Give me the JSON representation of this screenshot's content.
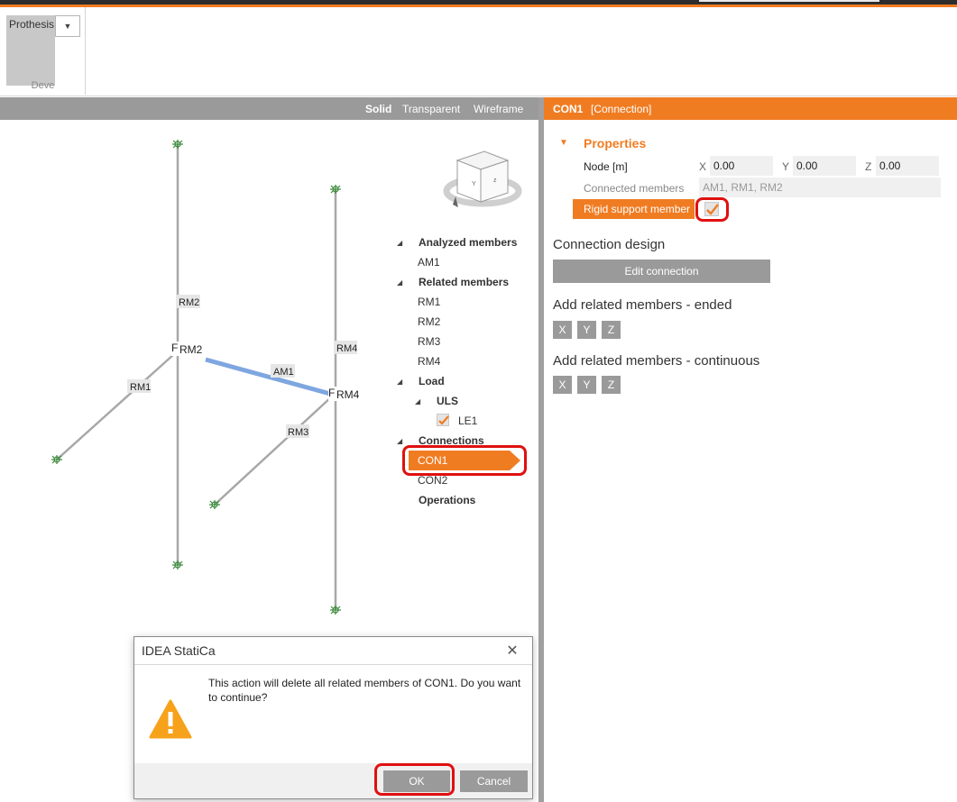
{
  "ribbon": {
    "button_label": "Prothesis",
    "dropdown_glyph": "▼",
    "group_caption": "Deve"
  },
  "view_bar": {
    "solid": "Solid",
    "transparent": "Transparent",
    "wireframe": "Wireframe"
  },
  "model": {
    "member_labels": [
      "RM2",
      "RM4",
      "RM1",
      "AM1",
      "RM3"
    ],
    "node_labels": [
      "RM2",
      "RM4"
    ],
    "node_prefix": "F",
    "support_icon": "support-icon",
    "view_cube_icon": "view-cube-icon",
    "cube_face_labels": [
      "Y",
      "z"
    ]
  },
  "tree": {
    "analyzed_members": "Analyzed members",
    "am1": "AM1",
    "related_members": "Related members",
    "rm1": "RM1",
    "rm2": "RM2",
    "rm3": "RM3",
    "rm4": "RM4",
    "load": "Load",
    "uls": "ULS",
    "le1": "LE1",
    "connections": "Connections",
    "con1": "CON1",
    "con2": "CON2",
    "operations": "Operations"
  },
  "right_panel": {
    "header_name": "CON1",
    "header_type": "[Connection]",
    "properties_title": "Properties",
    "node_label": "Node [m]",
    "x_axis": "X",
    "y_axis": "Y",
    "z_axis": "Z",
    "x_value": "0.00",
    "y_value": "0.00",
    "z_value": "0.00",
    "connected_members_label": "Connected members",
    "connected_members_value": "AM1, RM1, RM2",
    "rigid_support_label": "Rigid support member",
    "rigid_support_checked": true,
    "connection_design_title": "Connection design",
    "edit_connection": "Edit connection",
    "add_ended_title": "Add related members - ended",
    "add_continuous_title": "Add related members - continuous",
    "btn_x": "X",
    "btn_y": "Y",
    "btn_z": "Z"
  },
  "dialog": {
    "title": "IDEA StatiCa",
    "close_glyph": "✕",
    "message": "This action will delete all related members of CON1. Do you want to continue?",
    "ok": "OK",
    "cancel": "Cancel",
    "warning_icon": "warning-icon"
  },
  "colors": {
    "accent": "#f07c22",
    "highlight_red": "#e01010",
    "button_grey": "#9a9a9a",
    "analyzed_member_blue": "#7ea6e0"
  }
}
